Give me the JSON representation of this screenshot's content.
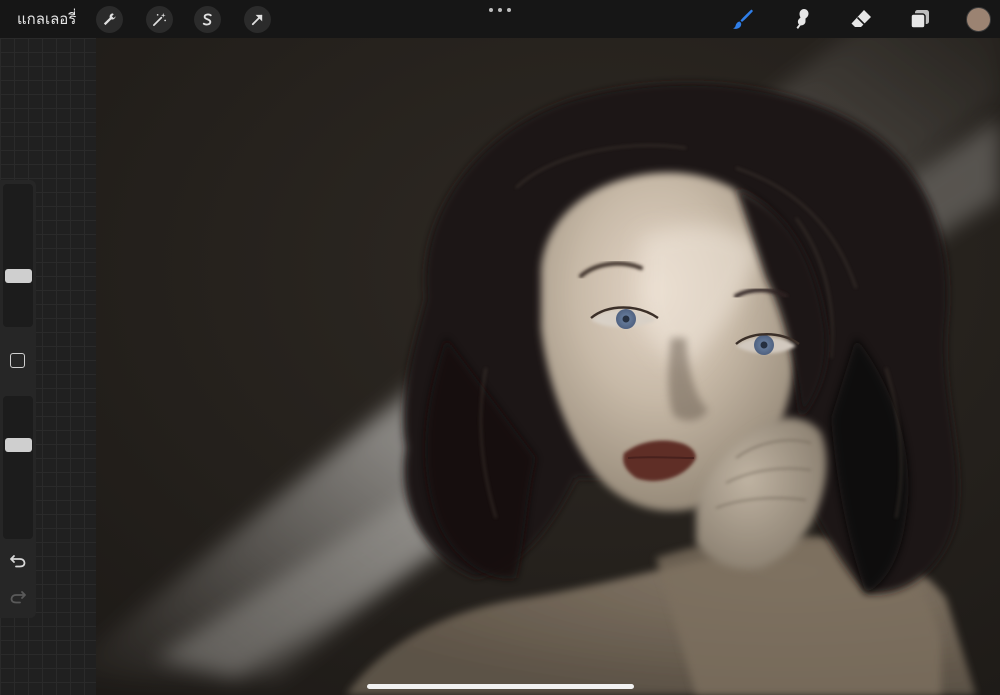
{
  "topbar": {
    "gallery_label": "แกลเลอรี่",
    "left_tools": [
      {
        "name": "actions",
        "icon": "wrench-icon"
      },
      {
        "name": "adjustments",
        "icon": "magic-wand-icon"
      },
      {
        "name": "selection",
        "icon": "selection-s-icon"
      },
      {
        "name": "transform",
        "icon": "arrow-cursor-icon"
      }
    ],
    "more_icon": "more-dots-icon",
    "right_tools": [
      {
        "name": "brush",
        "icon": "brush-icon",
        "active": true
      },
      {
        "name": "smudge",
        "icon": "smudge-icon",
        "active": false
      },
      {
        "name": "eraser",
        "icon": "eraser-icon",
        "active": false
      },
      {
        "name": "layers",
        "icon": "layers-icon",
        "active": false
      }
    ],
    "current_color": "#9b8372",
    "accent_color": "#2f7ee8"
  },
  "sidebar": {
    "brush_size_icon": "brush-size-slider",
    "opacity_icon": "opacity-slider",
    "modify_icon": "square-modify-icon",
    "undo_icon": "undo-arrow-icon",
    "redo_icon": "redo-arrow-icon"
  }
}
